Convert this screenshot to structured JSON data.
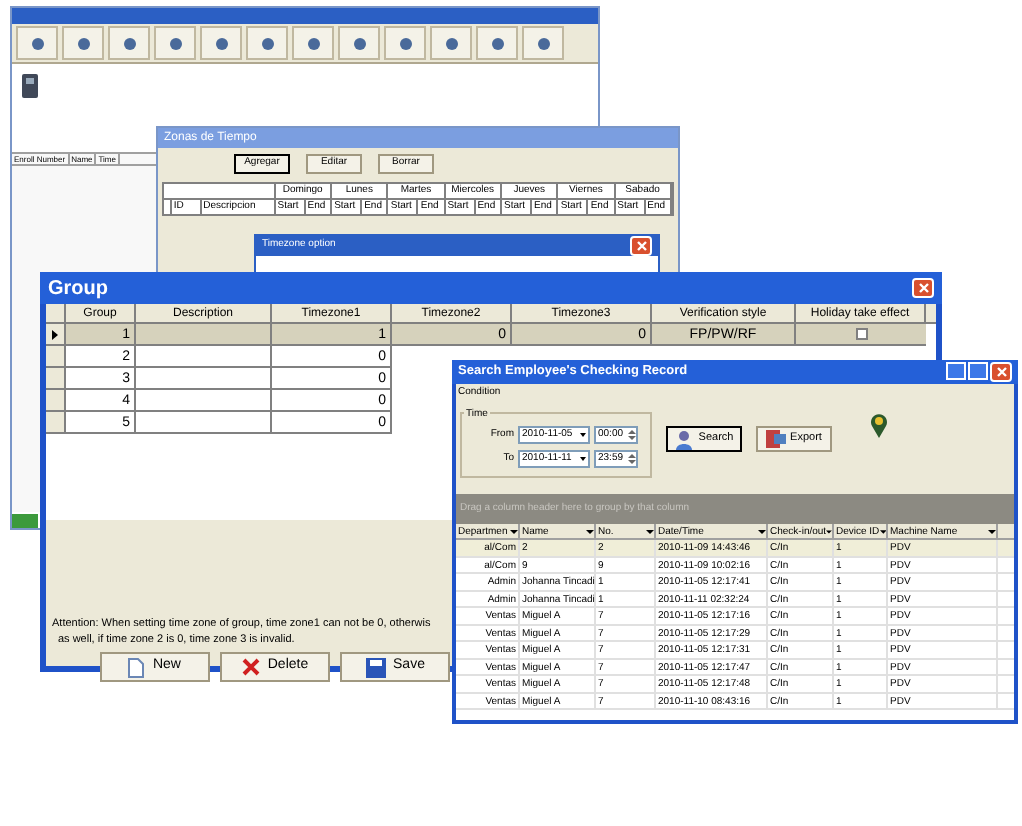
{
  "main_window": {
    "event_panel": {
      "columns": [
        "Enroll Number",
        "Name",
        "Time"
      ]
    }
  },
  "zonas_window": {
    "title": "Zonas de Tiempo",
    "buttons": [
      {
        "label": "Agregar",
        "selected": true
      },
      {
        "label": "Editar",
        "selected": false
      },
      {
        "label": "Borrar",
        "selected": false
      }
    ],
    "columns": [
      "ID",
      "Descripcion"
    ],
    "days": [
      {
        "name": "Domingo",
        "start": "Start",
        "end": "End"
      },
      {
        "name": "Lunes",
        "start": "Start",
        "end": "End"
      },
      {
        "name": "Martes",
        "start": "Start",
        "end": "End"
      },
      {
        "name": "Miercoles",
        "start": "Start",
        "end": "End"
      },
      {
        "name": "Jueves",
        "start": "Start",
        "end": "End"
      },
      {
        "name": "Viernes",
        "start": "Start",
        "end": "End"
      },
      {
        "name": "Sabado",
        "start": "Start",
        "end": "End"
      }
    ]
  },
  "timezone_window": {
    "title": "Timezone option"
  },
  "group_window": {
    "title": "Group",
    "columns": [
      "Group",
      "Description",
      "Timezone1",
      "Timezone2",
      "Timezone3",
      "Verification style",
      "Holiday take effect"
    ],
    "rows": [
      {
        "selected": true,
        "cells": [
          "1",
          "",
          "1",
          "0",
          "0",
          "FP/PW/RF"
        ],
        "holiday": false
      },
      {
        "selected": false,
        "cells": [
          "2",
          "",
          "0"
        ]
      },
      {
        "selected": false,
        "cells": [
          "3",
          "",
          "0"
        ]
      },
      {
        "selected": false,
        "cells": [
          "4",
          "",
          "0"
        ]
      },
      {
        "selected": false,
        "cells": [
          "5",
          "",
          "0"
        ]
      }
    ],
    "attention": [
      "Attention: When setting time zone of group, time zone1 can not be 0, otherwis",
      "as well, if time zone 2 is 0, time zone 3 is invalid."
    ],
    "buttons": [
      {
        "label": "New",
        "kind": "new"
      },
      {
        "label": "Delete",
        "kind": "delete"
      },
      {
        "label": "Save",
        "kind": "save"
      }
    ]
  },
  "search_window": {
    "title": "Search Employee's Checking Record",
    "condition_label": "Condition",
    "time_label": "Time",
    "from": {
      "label": "From",
      "date": "2010-11-05",
      "time": "00:00"
    },
    "to": {
      "label": "To",
      "date": "2010-11-11",
      "time": "23:59"
    },
    "buttons": [
      {
        "label": "Search",
        "kind": "search"
      },
      {
        "label": "Export",
        "kind": "export"
      }
    ],
    "group_hint": "Drag a column header here to group by that column",
    "columns": [
      "Departmen",
      "Name",
      "No.",
      "Date/Time",
      "Check-in/out",
      "Device ID",
      "Machine Name"
    ],
    "rows": [
      {
        "selected": true,
        "cells": [
          "al/Com",
          "2",
          "2",
          "2010-11-09 14:43:46",
          "C/In",
          "1",
          "PDV"
        ]
      },
      {
        "selected": false,
        "cells": [
          "al/Com",
          "9",
          "9",
          "2010-11-09 10:02:16",
          "C/In",
          "1",
          "PDV"
        ]
      },
      {
        "selected": false,
        "cells": [
          "Admin",
          "Johanna Tincadi",
          "1",
          "2010-11-05 12:17:41",
          "C/In",
          "1",
          "PDV"
        ]
      },
      {
        "selected": false,
        "cells": [
          "Admin",
          "Johanna Tincadi",
          "1",
          "2010-11-11 02:32:24",
          "C/In",
          "1",
          "PDV"
        ]
      },
      {
        "selected": false,
        "cells": [
          "Ventas",
          "Miguel A",
          "7",
          "2010-11-05 12:17:16",
          "C/In",
          "1",
          "PDV"
        ]
      },
      {
        "selected": false,
        "cells": [
          "Ventas",
          "Miguel A",
          "7",
          "2010-11-05 12:17:29",
          "C/In",
          "1",
          "PDV"
        ]
      },
      {
        "selected": false,
        "cells": [
          "Ventas",
          "Miguel A",
          "7",
          "2010-11-05 12:17:31",
          "C/In",
          "1",
          "PDV"
        ]
      },
      {
        "selected": false,
        "cells": [
          "Ventas",
          "Miguel A",
          "7",
          "2010-11-05 12:17:47",
          "C/In",
          "1",
          "PDV"
        ]
      },
      {
        "selected": false,
        "cells": [
          "Ventas",
          "Miguel A",
          "7",
          "2010-11-05 12:17:48",
          "C/In",
          "1",
          "PDV"
        ]
      },
      {
        "selected": false,
        "cells": [
          "Ventas",
          "Miguel A",
          "7",
          "2010-11-10 08:43:16",
          "C/In",
          "1",
          "PDV"
        ]
      }
    ]
  }
}
